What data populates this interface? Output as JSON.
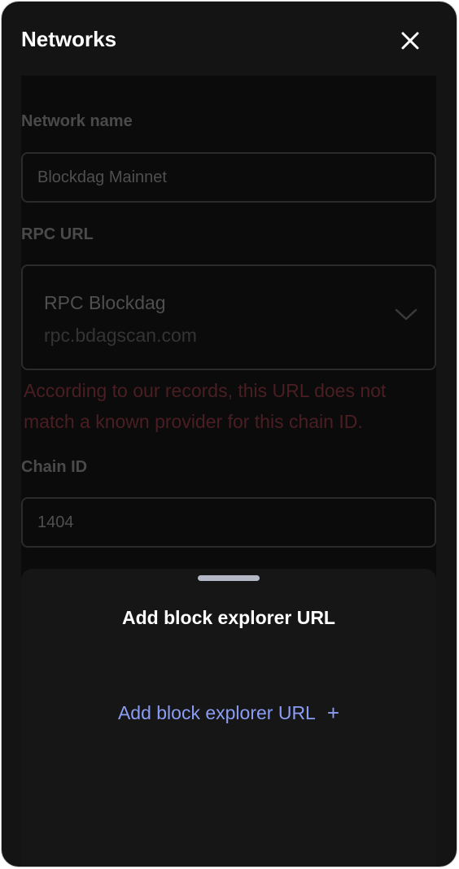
{
  "header": {
    "title": "Networks"
  },
  "form": {
    "network_name": {
      "label": "Network name",
      "value": "Blockdag Mainnet"
    },
    "rpc_url": {
      "label": "RPC URL",
      "selected_name": "RPC Blockdag",
      "selected_url": "rpc.bdagscan.com",
      "warning": "According to our records, this URL does not match a known provider for this chain ID."
    },
    "chain_id": {
      "label": "Chain ID",
      "value": "1404"
    }
  },
  "sheet": {
    "title": "Add block explorer URL",
    "add_link_label": "Add block explorer URL",
    "add_icon": "plus-icon"
  },
  "colors": {
    "background": "#141414",
    "link": "#8b9cf4",
    "warning": "#4a1e22"
  }
}
